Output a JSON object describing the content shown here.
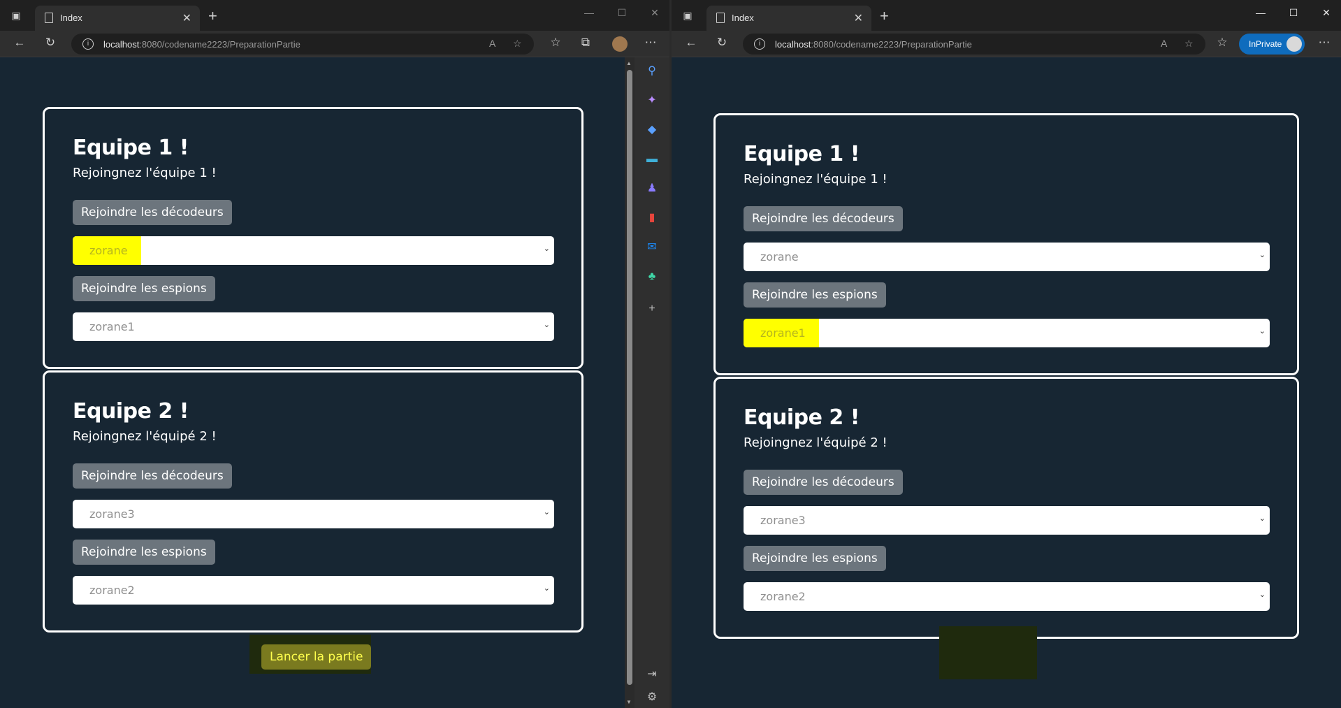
{
  "browser": {
    "tab_title": "Index",
    "url_host": "localhost",
    "url_path": ":8080/codename2223/PreparationPartie",
    "inprivate_label": "InPrivate"
  },
  "left": {
    "team1": {
      "title": "Equipe 1 !",
      "subtitle": "Rejoingnez l'équipe 1 !",
      "decoders_button": "Rejoindre les décodeurs",
      "decoders_select": "zorane",
      "spies_button": "Rejoindre les espions",
      "spies_select": "zorane1"
    },
    "team2": {
      "title": "Equipe 2 !",
      "subtitle": "Rejoingnez l'équipé 2 !",
      "decoders_button": "Rejoindre les décodeurs",
      "decoders_select": "zorane3",
      "spies_button": "Rejoindre les espions",
      "spies_select": "zorane2"
    },
    "launch_button": "Lancer la partie"
  },
  "right": {
    "team1": {
      "title": "Equipe 1 !",
      "subtitle": "Rejoingnez l'équipe 1 !",
      "decoders_button": "Rejoindre les décodeurs",
      "decoders_select": "zorane",
      "spies_button": "Rejoindre les espions",
      "spies_select": "zorane1"
    },
    "team2": {
      "title": "Equipe 2 !",
      "subtitle": "Rejoingnez l'équipé 2 !",
      "decoders_button": "Rejoindre les décodeurs",
      "decoders_select": "zorane3",
      "spies_button": "Rejoindre les espions",
      "spies_select": "zorane2"
    }
  },
  "colors": {
    "page_bg": "#172633",
    "button_gray": "#6c757d",
    "highlight": "#ffff00"
  }
}
